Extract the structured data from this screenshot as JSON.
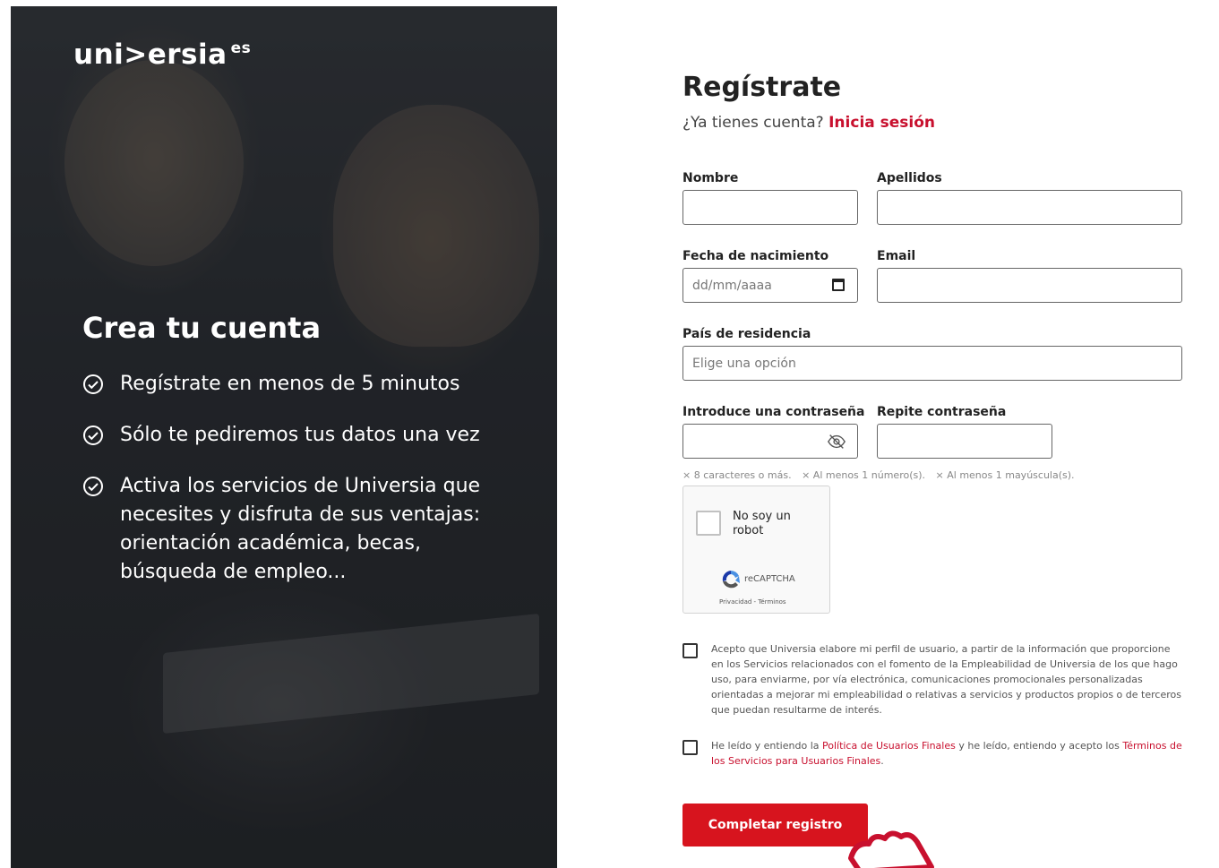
{
  "hero": {
    "logo_text": "uni>ersia",
    "logo_suffix": "es",
    "headline": "Crea tu cuenta",
    "benefits": [
      "Regístrate en menos de 5 minutos",
      "Sólo te pediremos tus datos una vez",
      "Activa los servicios de Universia que necesites y disfruta de sus ventajas: orientación académica, becas, búsqueda de empleo..."
    ],
    "check_icon": "check-circle-icon"
  },
  "form": {
    "title": "Regístrate",
    "login_prompt": "¿Ya tienes cuenta?",
    "login_link": "Inicia sesión",
    "fields": {
      "nombre": {
        "label": "Nombre",
        "value": ""
      },
      "apellidos": {
        "label": "Apellidos",
        "value": ""
      },
      "fecha": {
        "label": "Fecha de nacimiento",
        "placeholder": "dd/mm/aaaa"
      },
      "email": {
        "label": "Email",
        "value": ""
      },
      "pais": {
        "label": "País de residencia",
        "placeholder": "Elige una opción"
      },
      "password": {
        "label": "Introduce una contraseña",
        "value": ""
      },
      "password_repeat": {
        "label": "Repite contraseña",
        "value": ""
      }
    },
    "password_hints": [
      "× 8 caracteres o más.",
      "× Al menos 1 número(s).",
      "× Al menos 1 mayúscula(s)."
    ],
    "captcha": {
      "label": "No soy un robot",
      "brand": "reCAPTCHA",
      "links": "Privacidad - Términos"
    },
    "consent_profile": "Acepto que Universia elabore mi perfil de usuario, a partir de la información que proporcione en los Servicios relacionados con el fomento de la Empleabilidad de Universia de los que hago uso, para enviarme, por vía electrónica, comunicaciones promocionales personalizadas orientadas a mejorar mi empleabilidad o relativas a servicios y productos propios o de terceros que puedan resultarme de interés.",
    "consent_terms_pre": "He leído y entiendo la ",
    "consent_terms_link1": "Política de Usuarios Finales",
    "consent_terms_mid": " y he leído, entiendo y acepto los ",
    "consent_terms_link2": "Términos de los Servicios para Usuarios Finales",
    "consent_terms_post": ".",
    "submit_label": "Completar registro"
  },
  "colors": {
    "accent": "#c8102e",
    "button": "#d7141e"
  }
}
